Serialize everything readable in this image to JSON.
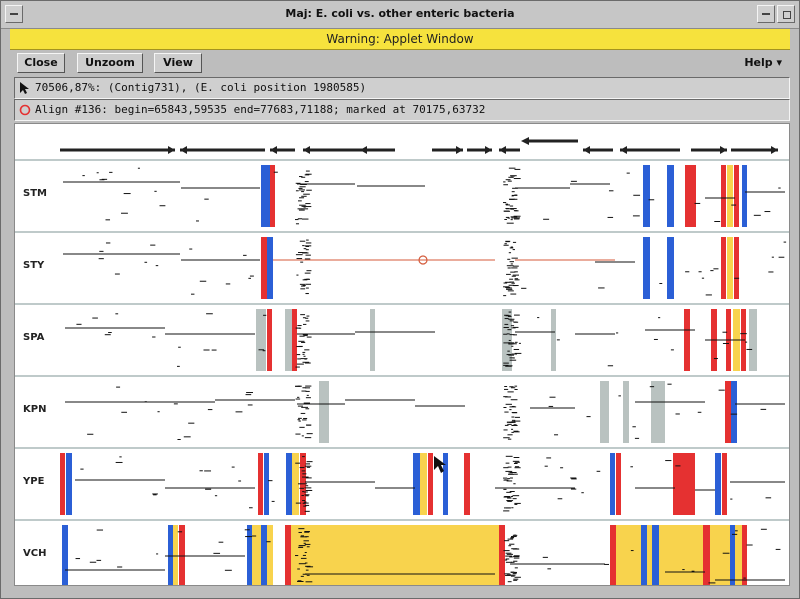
{
  "window": {
    "title": "Maj: E. coli vs. other enteric bacteria",
    "warning": "Warning: Applet Window"
  },
  "toolbar": {
    "close_label": "Close",
    "unzoom_label": "Unzoom",
    "view_label": "View",
    "help_label": "Help ▾"
  },
  "info": {
    "hover_line": "70506,87%: (Contig731), (E. coli position 1980585)",
    "align_line": "Align #136: begin=65843,59535 end=77683,71188; marked at 70175,63732"
  },
  "colors": {
    "blue": "#2b5fd6",
    "red": "#e53131",
    "yellow": "#f8d34d",
    "gray": "#b9c2c0",
    "highlight": "#d45a3a"
  },
  "icons": {
    "hover": "arrow-cursor-icon",
    "align": "red-circle-icon"
  },
  "tracks": [
    {
      "label": "STM"
    },
    {
      "label": "STY"
    },
    {
      "label": "SPA"
    },
    {
      "label": "KPN"
    },
    {
      "label": "YPE"
    },
    {
      "label": "VCH"
    }
  ]
}
